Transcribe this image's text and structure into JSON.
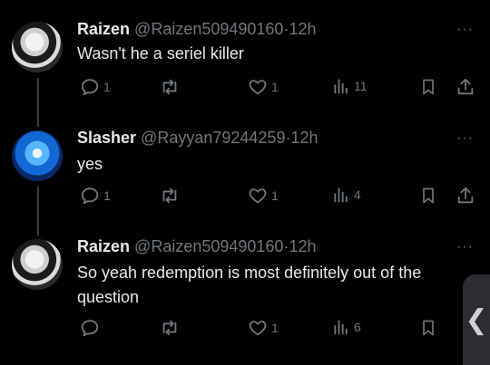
{
  "tweets": [
    {
      "name": "Raizen",
      "handle": "@Raizen509490160",
      "sep": "·",
      "time": "12h",
      "text": "Wasn't he a seriel killer",
      "replies": "1",
      "retweets": "",
      "likes": "1",
      "views": "11",
      "avatar": "raizen-avatar"
    },
    {
      "name": "Slasher",
      "handle": "@Rayyan79244259",
      "sep": "·",
      "time": "12h",
      "text": "yes",
      "replies": "1",
      "retweets": "",
      "likes": "1",
      "views": "4",
      "avatar": "slasher-avatar"
    },
    {
      "name": "Raizen",
      "handle": "@Raizen509490160",
      "sep": "·",
      "time": "12h",
      "text": "So yeah redemption is most definitely out of the question",
      "replies": "",
      "retweets": "",
      "likes": "1",
      "views": "6",
      "avatar": "raizen-avatar"
    }
  ],
  "more_icon": "···",
  "edge_tab_glyph": "❮",
  "colors": {
    "background": "#000000",
    "text": "#e7e9ea",
    "muted": "#71767b",
    "thread_line": "#3a3d40"
  }
}
